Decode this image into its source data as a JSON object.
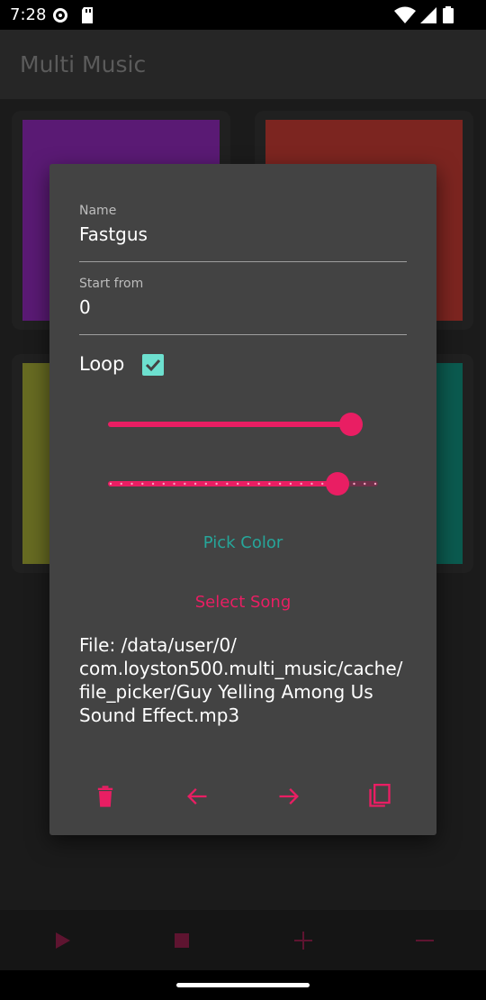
{
  "status_bar": {
    "time": "7:28",
    "icons": [
      "settings-icon",
      "sd-card-icon",
      "wifi-icon",
      "signal-icon",
      "battery-icon"
    ]
  },
  "app": {
    "title": "Multi Music"
  },
  "pads": [
    {
      "color": "#5a1a74"
    },
    {
      "color": "#7c2520"
    },
    {
      "color": "#676b22"
    },
    {
      "color": "#0b5a4f"
    }
  ],
  "dialog": {
    "name_label": "Name",
    "name_value": "Fastgus",
    "start_label": "Start from",
    "start_value": "0",
    "loop_label": "Loop",
    "loop_checked": true,
    "slider1_fraction": 0.9,
    "slider2_fraction": 0.85,
    "pick_color_label": "Pick Color",
    "select_song_label": "Select Song",
    "file_text": "File: /data/user/0/\ncom.loyston500.multi_music/cache/\nfile_picker/Guy Yelling Among Us\nSound Effect.mp3",
    "actions": [
      "delete-icon",
      "arrow-left-icon",
      "arrow-right-icon",
      "copy-icon"
    ]
  },
  "bottom_controls": [
    "play-icon",
    "stop-icon",
    "add-icon",
    "remove-icon"
  ],
  "colors": {
    "accent": "#e91e63",
    "teal": "#26a69a",
    "checkbox": "#6de0cf",
    "dialog_bg": "#434343"
  }
}
